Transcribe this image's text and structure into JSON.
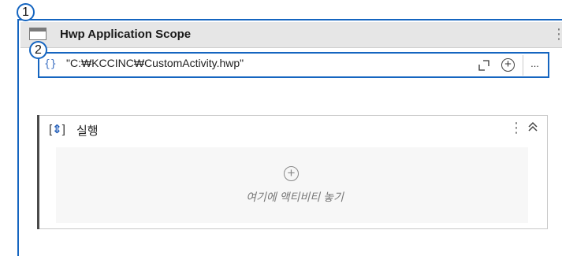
{
  "annotations": {
    "first": "1",
    "second": "2"
  },
  "scope": {
    "title": "Hwp Application Scope",
    "menu_glyph": "⋮",
    "icon": "window-icon"
  },
  "path_input": {
    "prefix_glyph": "{}",
    "value": "\"C:₩KCCINC₩CustomActivity.hwp\"",
    "expand_icon": "expand-icon",
    "plus_glyph": "+",
    "more_label": "..."
  },
  "sequence": {
    "icon": "sequence-icon",
    "icon_glyph_left": "[",
    "icon_glyph_arrow": "⇕",
    "icon_glyph_right": "]",
    "title": "실행",
    "menu_glyph": "⋮",
    "collapse_glyph": "⌃",
    "drop_plus_glyph": "+",
    "drop_text": "여기에 액티비티 놓기"
  },
  "colors": {
    "accent": "#1565c0",
    "header_bg": "#e6e6e6",
    "drop_bg": "#f7f7f7"
  }
}
